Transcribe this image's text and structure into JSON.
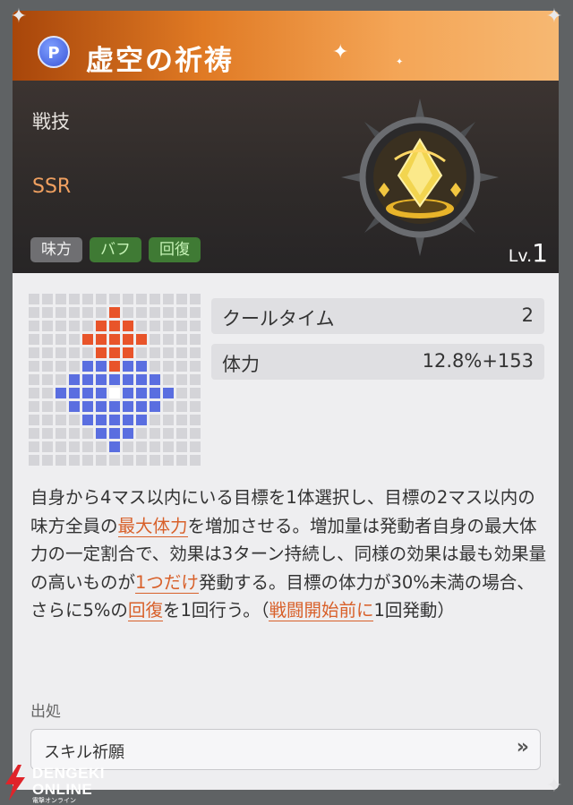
{
  "card": {
    "title": "虚空の祈祷",
    "icon_letter": "P",
    "category": "戦技",
    "rarity": "SSR",
    "tags": [
      "味方",
      "バフ",
      "回復"
    ],
    "level_prefix": "Lv.",
    "level_value": "1"
  },
  "stats": [
    {
      "label": "クールタイム",
      "value": "2"
    },
    {
      "label": "体力",
      "value": "12.8%+153"
    }
  ],
  "description": {
    "p1": "自身から4マス以内にいる目標を1体選択し、目標の2マス以内の味方全員の",
    "hl1": "最大体力",
    "p2": "を増加させる。増加量は発動者自身の最大体力の一定割合で、効果は3ターン持続し、同様の効果は最も効果量の高いものが",
    "hl2": "1つだけ",
    "p3": "発動する。目標の体力が30%未満の場合、さらに5%の",
    "hl3": "回復",
    "p4": "を1回行う。（",
    "hl4": "戦闘開始前に",
    "p5": "1回発動）"
  },
  "source": {
    "label": "出処",
    "value": "スキル祈願",
    "arrow": "»"
  },
  "watermark": {
    "line1": "DENGEKI",
    "line2": "ONLINE",
    "kana": "電撃オンライン"
  },
  "icons": {
    "skill": "p-token-icon",
    "emblem": "golden-crystal-emblem-icon",
    "forward": "double-chevron-right-icon"
  },
  "colors": {
    "title_gradient": [
      "#a8460a",
      "#f6b872"
    ],
    "rarity": "#f0a060",
    "highlight": "#d8602a",
    "range_target": "#e8542a",
    "range_area": "#5a6ee0",
    "range_center": "#ffffff",
    "range_empty": "#d4d4d8"
  }
}
